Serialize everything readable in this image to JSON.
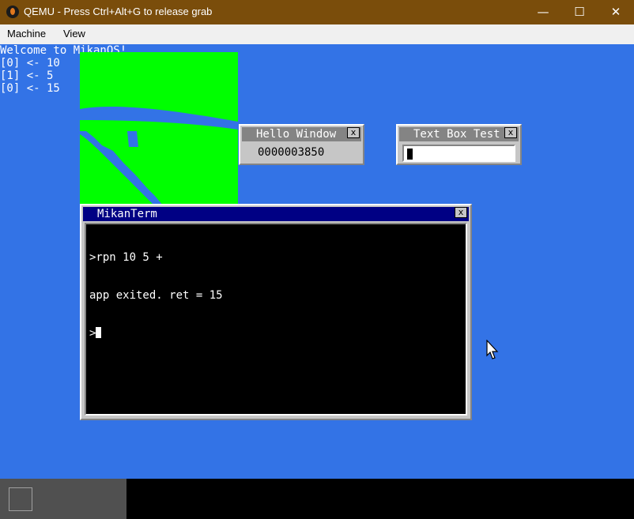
{
  "window": {
    "title": "QEMU - Press Ctrl+Alt+G to release grab"
  },
  "window_controls": {
    "minimize": "—",
    "maximize": "☐",
    "close": "✕"
  },
  "menubar": {
    "items": [
      {
        "label": "Machine"
      },
      {
        "label": "View"
      }
    ]
  },
  "console": {
    "lines": [
      "Welcome to MikanOS!",
      "[0] <- 10",
      "[1] <- 5",
      "[0] <- 15"
    ]
  },
  "hello_window": {
    "title": "Hello Window",
    "counter": "0000003850",
    "close_label": "x"
  },
  "textbox_window": {
    "title": "Text Box Test",
    "close_label": "x",
    "value": ""
  },
  "terminal": {
    "title": "MikanTerm",
    "close_label": "x",
    "lines": [
      ">rpn 10 5 +",
      "app exited. ret = 15",
      ">"
    ]
  },
  "colors": {
    "desktop": "#3373e6",
    "titlebar": "#7a4d0b",
    "window_title": "#848484",
    "terminal_title": "#000084",
    "green_canvas": "#00ff00"
  },
  "icons": {
    "app": "qemu-icon",
    "cursor": "mouse-cursor-icon"
  }
}
